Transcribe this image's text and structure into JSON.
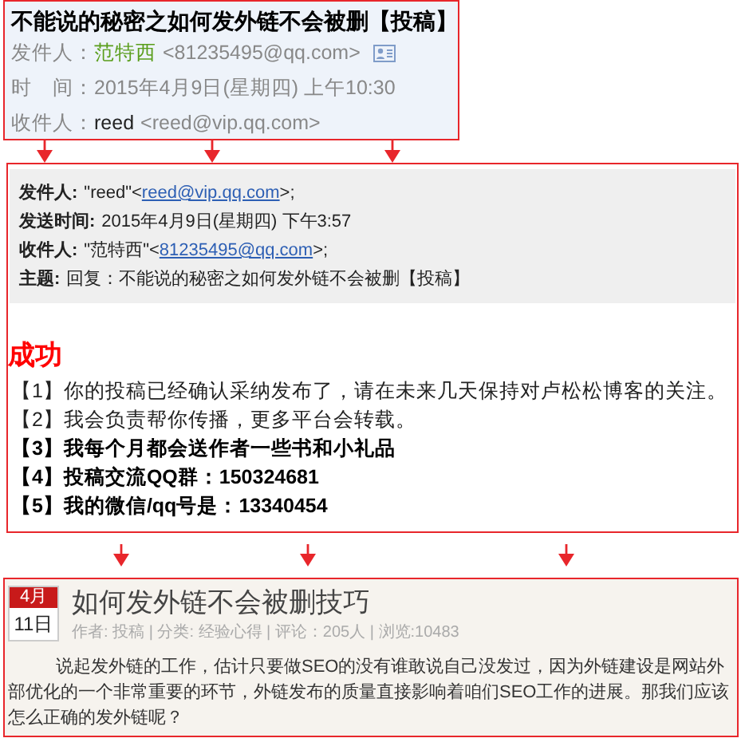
{
  "qq_mail": {
    "subject": "不能说的秘密之如何发外链不会被删【投稿】",
    "rows": [
      {
        "label": "发件人：",
        "name": "范特西",
        "value": "<81235495@qq.com>",
        "card": true
      },
      {
        "label": "时　间：",
        "value": "2015年4月9日(星期四) 上午10:30",
        "card": false
      },
      {
        "label": "收件人：",
        "name": "reed",
        "value": "<reed@vip.qq.com>",
        "card": false
      }
    ]
  },
  "reply_mail": {
    "header": [
      {
        "label": "发件人:",
        "before": "\"reed\"<",
        "link": "reed@vip.qq.com",
        "after": ">;"
      },
      {
        "label": "发送时间:",
        "before": "2015年4月9日(星期四) 下午3:57"
      },
      {
        "label": "收件人:",
        "before": "\"范特西\"<",
        "link": "81235495@qq.com",
        "after": ">;"
      },
      {
        "label": "主题:",
        "before": "回复：不能说的秘密之如何发外链不会被删【投稿】"
      }
    ],
    "status": "成功",
    "items": [
      {
        "text": "【1】你的投稿已经确认采纳发布了，请在未来几天保持对卢松松博客的关注。",
        "bold": false
      },
      {
        "text": "【2】我会负责帮你传播，更多平台会转载。",
        "bold": false
      },
      {
        "text": "【3】我每个月都会送作者一些书和小礼品",
        "bold": true
      },
      {
        "text": "【4】投稿交流QQ群：150324681",
        "bold": true
      },
      {
        "text": "【5】我的微信/qq号是：13340454",
        "bold": true
      }
    ]
  },
  "blog_post": {
    "month": "4月",
    "day": "11日",
    "title": "如何发外链不会被删技巧",
    "meta": "作者: 投稿 | 分类: 经验心得 | 评论：205人 | 浏览:10483",
    "paragraph": "说起发外链的工作，估计只要做SEO的没有谁敢说自己没发过，因为外链建设是网站外部优化的一个非常重要的环节，外链发布的质量直接影响着咱们SEO工作的进展。那我们应该怎么正确的发外链呢？"
  }
}
